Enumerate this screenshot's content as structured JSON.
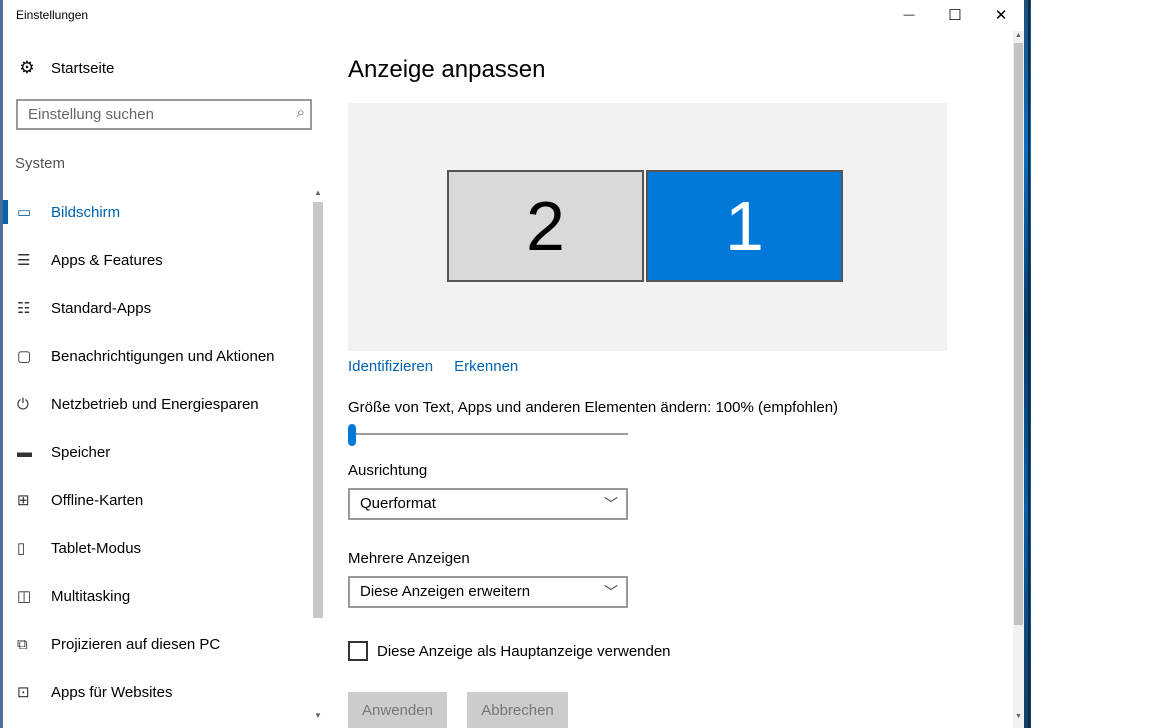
{
  "window": {
    "title": "Einstellungen",
    "controls": {
      "minimize": "—",
      "maximize": "☐",
      "close": "✕"
    }
  },
  "sidebar": {
    "home": {
      "icon": "gear-icon",
      "glyph": "⚙",
      "label": "Startseite"
    },
    "search": {
      "placeholder": "Einstellung suchen",
      "icon": "search-icon",
      "glyph": "⌕"
    },
    "group_label": "System",
    "items": [
      {
        "key": "bildschirm",
        "label": "Bildschirm",
        "icon": "monitor-icon",
        "glyph": "▭",
        "active": true
      },
      {
        "key": "apps-features",
        "label": "Apps & Features",
        "icon": "list-icon",
        "glyph": "☰",
        "active": false
      },
      {
        "key": "standard-apps",
        "label": "Standard-Apps",
        "icon": "list-check-icon",
        "glyph": "☷",
        "active": false
      },
      {
        "key": "benachrichtigungen",
        "label": "Benachrichtigungen und Aktionen",
        "icon": "notification-icon",
        "glyph": "▢",
        "active": false
      },
      {
        "key": "netzbetrieb",
        "label": "Netzbetrieb und Energiesparen",
        "icon": "power-icon",
        "glyph": "⏻",
        "active": false
      },
      {
        "key": "speicher",
        "label": "Speicher",
        "icon": "storage-icon",
        "glyph": "▬",
        "active": false
      },
      {
        "key": "offline-karten",
        "label": "Offline-Karten",
        "icon": "map-icon",
        "glyph": "⊞",
        "active": false
      },
      {
        "key": "tablet-modus",
        "label": "Tablet-Modus",
        "icon": "tablet-icon",
        "glyph": "▯",
        "active": false
      },
      {
        "key": "multitasking",
        "label": "Multitasking",
        "icon": "multitasking-icon",
        "glyph": "◫",
        "active": false
      },
      {
        "key": "projizieren",
        "label": "Projizieren auf diesen PC",
        "icon": "project-icon",
        "glyph": "⧉",
        "active": false
      },
      {
        "key": "apps-websites",
        "label": "Apps für Websites",
        "icon": "link-icon",
        "glyph": "⊡",
        "active": false
      }
    ]
  },
  "main": {
    "heading": "Anzeige anpassen",
    "monitors": [
      {
        "label": "2",
        "selected": false
      },
      {
        "label": "1",
        "selected": true
      }
    ],
    "links": {
      "identify": "Identifizieren",
      "detect": "Erkennen"
    },
    "scale": {
      "label": "Größe von Text, Apps und anderen Elementen ändern: 100% (empfohlen)",
      "value_percent": 100,
      "slider_fraction": 0
    },
    "orientation": {
      "label": "Ausrichtung",
      "value": "Querformat"
    },
    "multiple": {
      "label": "Mehrere Anzeigen",
      "value": "Diese Anzeigen erweitern"
    },
    "main_display": {
      "label": "Diese Anzeige als Hauptanzeige verwenden",
      "checked": false
    },
    "buttons": {
      "apply": "Anwenden",
      "cancel": "Abbrechen"
    }
  },
  "colors": {
    "accent": "#0078d7",
    "link": "#0063b1",
    "monitor_inactive": "#d9d9d9",
    "display_area_bg": "#f2f2f2",
    "button_disabled": "#cccccc"
  }
}
